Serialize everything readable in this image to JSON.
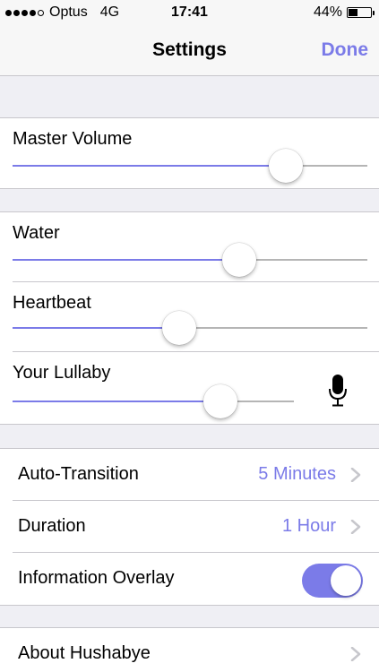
{
  "status_bar": {
    "carrier": "Optus",
    "network": "4G",
    "time": "17:41",
    "battery_text": "44%",
    "battery_level": 0.44,
    "signal_bars_filled": 4,
    "signal_bars_total": 5
  },
  "nav": {
    "title": "Settings",
    "done_label": "Done"
  },
  "master": {
    "label": "Master Volume",
    "value": 0.77
  },
  "sounds": [
    {
      "label": "Water",
      "value": 0.64
    },
    {
      "label": "Heartbeat",
      "value": 0.47
    },
    {
      "label": "Your Lullaby",
      "value": 0.74
    }
  ],
  "options": {
    "auto_transition": {
      "label": "Auto-Transition",
      "value": "5 Minutes"
    },
    "duration": {
      "label": "Duration",
      "value": "1 Hour"
    },
    "information_overlay": {
      "label": "Information Overlay",
      "on": true
    }
  },
  "about": {
    "label": "About Hushabye"
  },
  "icons": {
    "microphone": "microphone-icon",
    "chevron": "chevron-right-icon",
    "battery": "battery-icon"
  },
  "colors": {
    "accent": "#7b7be8",
    "track": "#b5b5b5",
    "background": "#efeff4"
  }
}
